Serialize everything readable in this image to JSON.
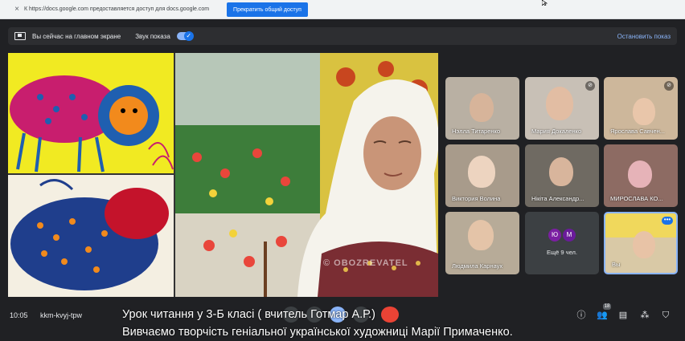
{
  "share_bar": {
    "close": "×",
    "message": "К https://docs.google.com предоставляется доступ для docs.google.com",
    "stop_button": "Прекратить общий доступ"
  },
  "presenting": {
    "label": "Вы сейчас на главном экране",
    "sound_label": "Звук показа",
    "sound_on": true,
    "stop": "Остановить показ"
  },
  "stage": {
    "watermark": "© OBOZREVATEL"
  },
  "tiles": [
    {
      "name": "Нэлла Титаренко"
    },
    {
      "name": "Мария Докаленко",
      "muted": true
    },
    {
      "name": "Ярослава Савчен...",
      "muted": true
    },
    {
      "name": "Виктория Волина"
    },
    {
      "name": "Нікіта Александр..."
    },
    {
      "name": "МИРОСЛАВА КО..."
    },
    {
      "name": "Людмила Карнаух"
    },
    {
      "avatars": [
        "Ю",
        "М"
      ],
      "more_label": "Ещё 9 чел."
    },
    {
      "name": "Вы"
    }
  ],
  "bottom": {
    "time": "10:05",
    "meeting_code": "kkm-kvyj-tpw",
    "participants_count": "18"
  },
  "caption": {
    "line1": "Урок читання у 3-Б класі ( вчитель Готмар А.Р.)",
    "line2": "Вивчаємо творчість геніальної української художниці Марії Примаченко."
  },
  "icons": {
    "present": "present-screen-icon",
    "info": "info-icon",
    "people": "people-icon",
    "chat": "chat-icon",
    "activities": "activities-icon",
    "host": "host-controls-icon"
  },
  "colors": {
    "accent": "#1a73e8",
    "link": "#8ab4f8",
    "leave": "#ea4335",
    "background": "#202124"
  }
}
